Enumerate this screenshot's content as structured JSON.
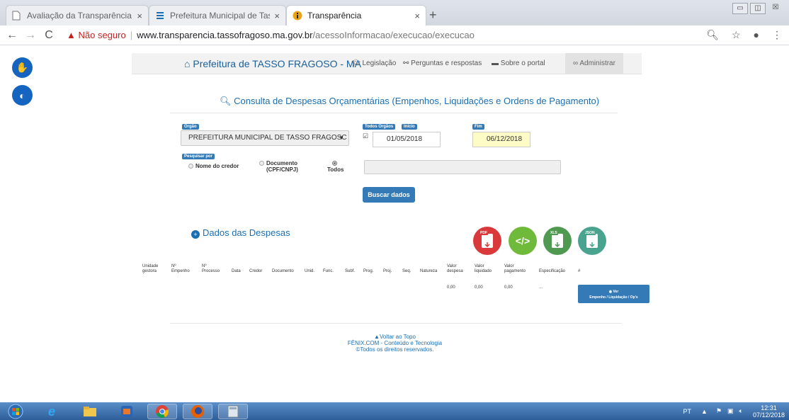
{
  "browser": {
    "tabs": [
      {
        "title": "Avaliação da Transparência dos",
        "active": false
      },
      {
        "title": "Prefeitura Municipal de Tasso Fra",
        "active": false
      },
      {
        "title": "Transparência",
        "active": true
      }
    ],
    "address": {
      "warning": "Não seguro",
      "host": "www.transparencia.tassofragoso.ma.gov.br",
      "path": "/acessoInformacao/execucao/execucao"
    }
  },
  "nav": {
    "home": "Prefeitura de TASSO FRAGOSO - MA",
    "items": [
      "Legislação",
      "Perguntas e respostas",
      "Sobre o portal"
    ],
    "admin": "Administrar"
  },
  "consulta_title": "Consulta de Despesas Orçamentárias (Empenhos, Liquidações e Ordens de Pagamento)",
  "form": {
    "orgao_label": "Orgão",
    "orgao_value": "PREFEITURA MUNICIPAL DE TASSO FRAGOSC",
    "todos_orgaos_label": "Todos Orgãos",
    "inicio_label": "Início",
    "inicio_value": "01/05/2018",
    "fim_label": "Fim",
    "fim_value": "06/12/2018",
    "pesquisar_label": "Pesquisar por",
    "radio_nome": "Nome do credor",
    "radio_doc_1": "Documento",
    "radio_doc_2": "(CPF/CNPJ)",
    "radio_todos": "Todos",
    "buscar_label": "Buscar dados"
  },
  "dados_title": "Dados das Despesas",
  "downloads": [
    {
      "name": "PDF",
      "color": "#d9393a"
    },
    {
      "name": "code",
      "color": "#6fba3a"
    },
    {
      "name": "XLS",
      "color": "#4f9a50"
    },
    {
      "name": "JSON",
      "color": "#4aa38e"
    }
  ],
  "table": {
    "headers": [
      {
        "l1": "Unidade",
        "l2": "gestora"
      },
      {
        "l1": "Nº",
        "l2": "Empenho"
      },
      {
        "l1": "Nº",
        "l2": "Processo"
      },
      {
        "l1": "",
        "l2": "Data"
      },
      {
        "l1": "",
        "l2": "Credor"
      },
      {
        "l1": "",
        "l2": "Documento"
      },
      {
        "l1": "",
        "l2": "Unid."
      },
      {
        "l1": "",
        "l2": "Func."
      },
      {
        "l1": "",
        "l2": "Subf."
      },
      {
        "l1": "",
        "l2": "Prog."
      },
      {
        "l1": "",
        "l2": "Proj."
      },
      {
        "l1": "",
        "l2": "Seq."
      },
      {
        "l1": "",
        "l2": "Natureza"
      },
      {
        "l1": "Valor",
        "l2": "despesa"
      },
      {
        "l1": "Valor",
        "l2": "liquidado"
      },
      {
        "l1": "Valor",
        "l2": "pagamento"
      },
      {
        "l1": "",
        "l2": "Especificação"
      },
      {
        "l1": "",
        "l2": "#"
      }
    ],
    "row": {
      "despesa": "0,00",
      "liquidado": "0,00",
      "pagamento": "0,00",
      "especificacao": "...",
      "ver_1": "Ver",
      "ver_2": "Empenho / Liquidação / Op's"
    }
  },
  "footer": {
    "voltar": "Voltar ao Topo",
    "company": "FÊNIX.COM - Conteúdo e Tecnologia",
    "rights": "©Todos os direitos reservados."
  },
  "taskbar": {
    "lang": "PT",
    "time": "12:31",
    "date": "07/12/2018"
  }
}
